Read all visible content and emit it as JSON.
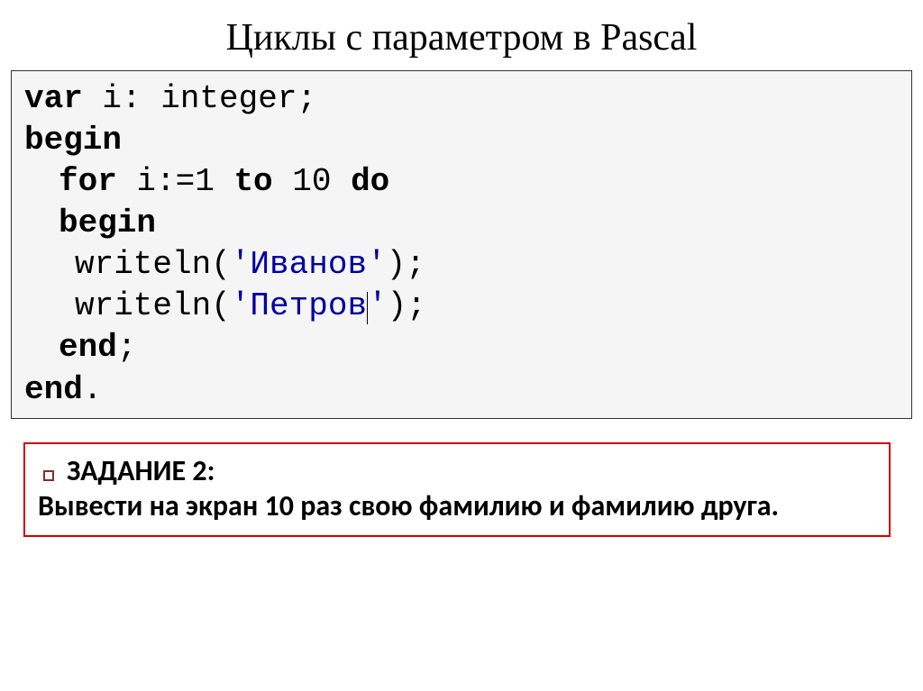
{
  "title": "Циклы с параметром в Pascal",
  "code": {
    "var_kw": "var",
    "var_line": " i: integer;",
    "begin_kw": "begin",
    "for_kw": "for",
    "for_mid": " i:=1 ",
    "to_kw": "to",
    "for_mid2": " 10 ",
    "do_kw": "do",
    "begin2_kw": "begin",
    "writeln1_pre": "writeln(",
    "writeln1_str": "'Иванов'",
    "writeln1_post": ");",
    "writeln2_pre": "writeln(",
    "writeln2_str_a": "'Петров",
    "writeln2_str_b": "'",
    "writeln2_post": ");",
    "end_inner": "end",
    "end_inner_post": ";",
    "end_outer": "end",
    "end_outer_post": "."
  },
  "task": {
    "title": "ЗАДАНИЕ 2:",
    "text": "Вывести на экран 10 раз свою фамилию и фамилию друга."
  }
}
